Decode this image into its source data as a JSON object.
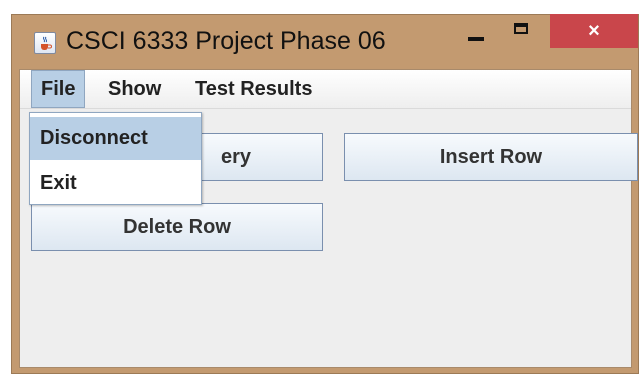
{
  "window": {
    "title": "CSCI 6333 Project Phase 06",
    "icon": "java-cup-icon",
    "close_label": "×"
  },
  "menubar": {
    "items": [
      {
        "label": "File",
        "active": true
      },
      {
        "label": "Show"
      },
      {
        "label": "Test Results"
      }
    ]
  },
  "file_menu": {
    "items": [
      {
        "label": "Disconnect",
        "highlighted": true
      },
      {
        "label": "Exit"
      }
    ]
  },
  "buttons": {
    "query_visible_text": "ery",
    "insert_row": "Insert Row",
    "delete_row": "Delete Row"
  },
  "colors": {
    "frame": "#c39a70",
    "close_button": "#c9464b",
    "menu_highlight": "#b8cfe5"
  }
}
